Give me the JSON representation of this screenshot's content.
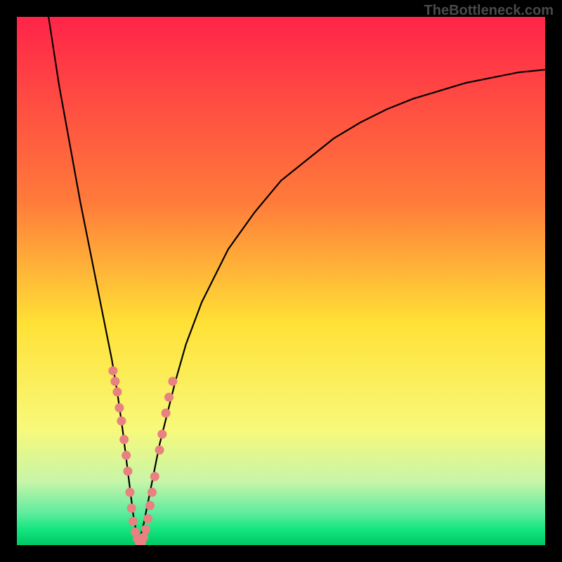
{
  "watermark": "TheBottleneck.com",
  "colors": {
    "background": "#000000",
    "curve": "#000000",
    "markers": "#e8817f",
    "gradient_top": "#ff2449",
    "gradient_mid": "#ffe136",
    "gradient_green": "#14e67f",
    "gradient_bottom": "#00c864"
  },
  "chart_data": {
    "type": "line",
    "title": "",
    "xlabel": "",
    "ylabel": "",
    "xlim": [
      0,
      100
    ],
    "ylim": [
      0,
      100
    ],
    "curve": {
      "description": "V-shaped bottleneck curve showing performance mismatch percentage",
      "minimum_x": 23,
      "x": [
        6,
        8,
        10,
        12,
        14,
        16,
        18,
        19,
        20,
        21,
        22,
        23,
        24,
        25,
        26,
        27,
        28,
        30,
        32,
        35,
        40,
        45,
        50,
        55,
        60,
        65,
        70,
        75,
        80,
        85,
        90,
        95,
        100
      ],
      "y": [
        100,
        87,
        76,
        65,
        55,
        45,
        35,
        29,
        22,
        14,
        6,
        0,
        4,
        9,
        14,
        19,
        23,
        31,
        38,
        46,
        56,
        63,
        69,
        73,
        77,
        80,
        82.5,
        84.5,
        86,
        87.5,
        88.5,
        89.5,
        90
      ]
    },
    "markers": {
      "description": "Component data points overlaid on the bottleneck curve",
      "points": [
        {
          "x": 18.2,
          "y": 33
        },
        {
          "x": 18.6,
          "y": 31
        },
        {
          "x": 19.0,
          "y": 29
        },
        {
          "x": 19.4,
          "y": 26
        },
        {
          "x": 19.8,
          "y": 23.5
        },
        {
          "x": 20.3,
          "y": 20
        },
        {
          "x": 20.7,
          "y": 17
        },
        {
          "x": 21.0,
          "y": 14
        },
        {
          "x": 21.4,
          "y": 10
        },
        {
          "x": 21.7,
          "y": 7
        },
        {
          "x": 22.0,
          "y": 4.5
        },
        {
          "x": 22.4,
          "y": 2.5
        },
        {
          "x": 22.8,
          "y": 1.2
        },
        {
          "x": 23.2,
          "y": 0.5
        },
        {
          "x": 23.6,
          "y": 0.5
        },
        {
          "x": 24.0,
          "y": 1.5
        },
        {
          "x": 24.4,
          "y": 3
        },
        {
          "x": 24.8,
          "y": 5
        },
        {
          "x": 25.2,
          "y": 7.5
        },
        {
          "x": 25.6,
          "y": 10
        },
        {
          "x": 26.1,
          "y": 13
        },
        {
          "x": 27.0,
          "y": 18
        },
        {
          "x": 27.5,
          "y": 21
        },
        {
          "x": 28.2,
          "y": 25
        },
        {
          "x": 28.8,
          "y": 28
        },
        {
          "x": 29.5,
          "y": 31
        }
      ]
    },
    "gradient_stops": [
      {
        "offset": 0,
        "color": "#ff2449"
      },
      {
        "offset": 35,
        "color": "#ff7b3a"
      },
      {
        "offset": 58,
        "color": "#ffe136"
      },
      {
        "offset": 78,
        "color": "#f8f97a"
      },
      {
        "offset": 88,
        "color": "#c7f5a8"
      },
      {
        "offset": 94,
        "color": "#5eeb9e"
      },
      {
        "offset": 97,
        "color": "#14e67f"
      },
      {
        "offset": 100,
        "color": "#00c864"
      }
    ]
  }
}
